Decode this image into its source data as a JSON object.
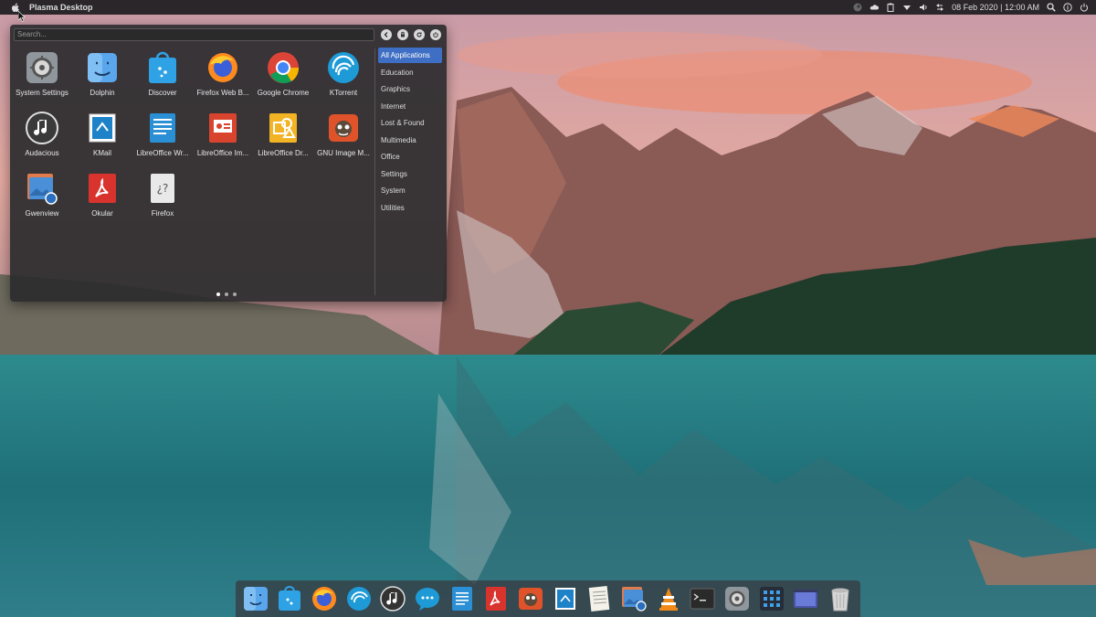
{
  "topbar": {
    "title": "Plasma Desktop",
    "clock": "08 Feb 2020 | 12:00 AM",
    "tray_icons": [
      "steam-icon",
      "cloud-icon",
      "clipboard-icon",
      "dropdown-icon",
      "volume-icon",
      "network-icon",
      "search-icon",
      "info-icon",
      "power-icon"
    ]
  },
  "launcher": {
    "search_placeholder": "Search...",
    "nav_buttons": [
      "back-icon",
      "lock-icon",
      "refresh-icon",
      "power-icon"
    ],
    "apps": [
      {
        "label": "System Settings",
        "icon": "system-settings-icon"
      },
      {
        "label": "Dolphin",
        "icon": "dolphin-icon"
      },
      {
        "label": "Discover",
        "icon": "discover-icon"
      },
      {
        "label": "Firefox Web B...",
        "icon": "firefox-icon"
      },
      {
        "label": "Google Chrome",
        "icon": "chrome-icon"
      },
      {
        "label": "KTorrent",
        "icon": "ktorrent-icon"
      },
      {
        "label": "Audacious",
        "icon": "audacious-icon"
      },
      {
        "label": "KMail",
        "icon": "kmail-icon"
      },
      {
        "label": "LibreOffice Wr...",
        "icon": "libreoffice-writer-icon"
      },
      {
        "label": "LibreOffice Im...",
        "icon": "libreoffice-impress-icon"
      },
      {
        "label": "LibreOffice Dr...",
        "icon": "libreoffice-draw-icon"
      },
      {
        "label": "GNU Image M...",
        "icon": "gimp-icon"
      },
      {
        "label": "Gwenview",
        "icon": "gwenview-icon"
      },
      {
        "label": "Okular",
        "icon": "okular-icon"
      },
      {
        "label": "Firefox",
        "icon": "unknown-app-icon"
      }
    ],
    "categories": [
      "All Applications",
      "Education",
      "Graphics",
      "Internet",
      "Lost & Found",
      "Multimedia",
      "Office",
      "Settings",
      "System",
      "Utilities"
    ],
    "selected_category": "All Applications",
    "pages": 3,
    "current_page": 1
  },
  "dock": {
    "items": [
      "dolphin-icon",
      "discover-icon",
      "firefox-icon",
      "ktorrent-icon",
      "audacious-icon",
      "chat-icon",
      "writer-icon",
      "okular-icon",
      "gimp-icon",
      "kmail-icon",
      "text-editor-icon",
      "gwenview-icon",
      "vlc-icon",
      "terminal-icon",
      "system-settings-icon",
      "app-grid-icon",
      "desktop-icon",
      "trash-icon"
    ]
  },
  "colors": {
    "accent": "#3f6fc4",
    "panel": "#1c1c1e",
    "launcher_bg": "#2c2c2e"
  }
}
